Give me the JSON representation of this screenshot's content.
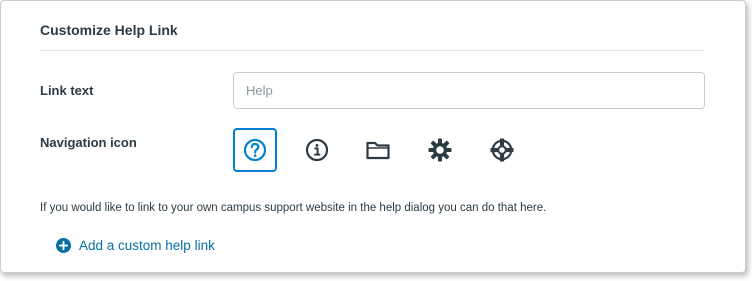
{
  "section": {
    "title": "Customize Help Link"
  },
  "link_text": {
    "label": "Link text",
    "placeholder": "Help",
    "value": ""
  },
  "navigation_icon": {
    "label": "Navigation icon",
    "selected": "question-icon",
    "options": [
      {
        "icon": "question-icon"
      },
      {
        "icon": "info-icon"
      },
      {
        "icon": "folder-icon"
      },
      {
        "icon": "gear-icon"
      },
      {
        "icon": "lifebuoy-icon"
      }
    ]
  },
  "info": {
    "text": "If you would like to link to your own campus support website in the help dialog you can do that here."
  },
  "add_link": {
    "label": "Add a custom help link",
    "icon": "plus-circle-icon"
  },
  "colors": {
    "accent": "#0081d6",
    "link": "#0770a3",
    "text": "#2d3b45"
  }
}
